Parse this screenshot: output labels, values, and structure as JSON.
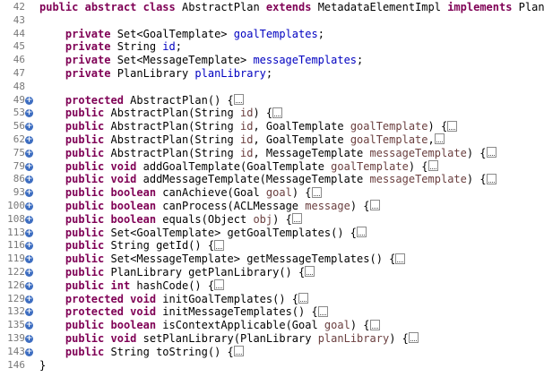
{
  "editor": {
    "lines": [
      {
        "num": "42",
        "fold": false,
        "tokens": [
          [
            "kw",
            "public"
          ],
          [
            "plain",
            " "
          ],
          [
            "kw",
            "abstract"
          ],
          [
            "plain",
            " "
          ],
          [
            "kw",
            "class"
          ],
          [
            "plain",
            " AbstractPlan "
          ],
          [
            "kw",
            "extends"
          ],
          [
            "plain",
            " MetadataElementImpl "
          ],
          [
            "kw",
            "implements"
          ],
          [
            "plain",
            " Plan {"
          ]
        ]
      },
      {
        "num": "43",
        "fold": false,
        "tokens": []
      },
      {
        "num": "44",
        "fold": false,
        "tokens": [
          [
            "plain",
            "    "
          ],
          [
            "kw",
            "private"
          ],
          [
            "plain",
            " Set<GoalTemplate> "
          ],
          [
            "fld",
            "goalTemplates"
          ],
          [
            "plain",
            ";"
          ]
        ]
      },
      {
        "num": "45",
        "fold": false,
        "tokens": [
          [
            "plain",
            "    "
          ],
          [
            "kw",
            "private"
          ],
          [
            "plain",
            " String "
          ],
          [
            "fld",
            "id"
          ],
          [
            "plain",
            ";"
          ]
        ]
      },
      {
        "num": "46",
        "fold": false,
        "tokens": [
          [
            "plain",
            "    "
          ],
          [
            "kw",
            "private"
          ],
          [
            "plain",
            " Set<MessageTemplate> "
          ],
          [
            "fld",
            "messageTemplates"
          ],
          [
            "plain",
            ";"
          ]
        ]
      },
      {
        "num": "47",
        "fold": false,
        "tokens": [
          [
            "plain",
            "    "
          ],
          [
            "kw",
            "private"
          ],
          [
            "plain",
            " PlanLibrary "
          ],
          [
            "fld",
            "planLibrary"
          ],
          [
            "plain",
            ";"
          ]
        ]
      },
      {
        "num": "48",
        "fold": false,
        "tokens": []
      },
      {
        "num": "49",
        "fold": true,
        "tokens": [
          [
            "plain",
            "    "
          ],
          [
            "kw",
            "protected"
          ],
          [
            "plain",
            " AbstractPlan() {"
          ],
          [
            "box",
            ""
          ]
        ]
      },
      {
        "num": "53",
        "fold": true,
        "tokens": [
          [
            "plain",
            "    "
          ],
          [
            "kw",
            "public"
          ],
          [
            "plain",
            " AbstractPlan(String "
          ],
          [
            "prm",
            "id"
          ],
          [
            "plain",
            ") {"
          ],
          [
            "box",
            ""
          ]
        ]
      },
      {
        "num": "56",
        "fold": true,
        "tokens": [
          [
            "plain",
            "    "
          ],
          [
            "kw",
            "public"
          ],
          [
            "plain",
            " AbstractPlan(String "
          ],
          [
            "prm",
            "id"
          ],
          [
            "plain",
            ", GoalTemplate "
          ],
          [
            "prm",
            "goalTemplate"
          ],
          [
            "plain",
            ") {"
          ],
          [
            "box",
            ""
          ]
        ]
      },
      {
        "num": "62",
        "fold": true,
        "tokens": [
          [
            "plain",
            "    "
          ],
          [
            "kw",
            "public"
          ],
          [
            "plain",
            " AbstractPlan(String "
          ],
          [
            "prm",
            "id"
          ],
          [
            "plain",
            ", GoalTemplate "
          ],
          [
            "prm",
            "goalTemplate"
          ],
          [
            "plain",
            ","
          ],
          [
            "box",
            ""
          ]
        ]
      },
      {
        "num": "75",
        "fold": true,
        "tokens": [
          [
            "plain",
            "    "
          ],
          [
            "kw",
            "public"
          ],
          [
            "plain",
            " AbstractPlan(String "
          ],
          [
            "prm",
            "id"
          ],
          [
            "plain",
            ", MessageTemplate "
          ],
          [
            "prm",
            "messageTemplate"
          ],
          [
            "plain",
            ") {"
          ],
          [
            "box",
            ""
          ]
        ]
      },
      {
        "num": "79",
        "fold": true,
        "tokens": [
          [
            "plain",
            "    "
          ],
          [
            "kw",
            "public"
          ],
          [
            "plain",
            " "
          ],
          [
            "kw",
            "void"
          ],
          [
            "plain",
            " addGoalTemplate(GoalTemplate "
          ],
          [
            "prm",
            "goalTemplate"
          ],
          [
            "plain",
            ") {"
          ],
          [
            "box",
            ""
          ]
        ]
      },
      {
        "num": "86",
        "fold": true,
        "tokens": [
          [
            "plain",
            "    "
          ],
          [
            "kw",
            "public"
          ],
          [
            "plain",
            " "
          ],
          [
            "kw",
            "void"
          ],
          [
            "plain",
            " addMessageTemplate(MessageTemplate "
          ],
          [
            "prm",
            "messageTemplate"
          ],
          [
            "plain",
            ") {"
          ],
          [
            "box",
            ""
          ]
        ]
      },
      {
        "num": "93",
        "fold": true,
        "tokens": [
          [
            "plain",
            "    "
          ],
          [
            "kw",
            "public"
          ],
          [
            "plain",
            " "
          ],
          [
            "kw",
            "boolean"
          ],
          [
            "plain",
            " canAchieve(Goal "
          ],
          [
            "prm",
            "goal"
          ],
          [
            "plain",
            ") {"
          ],
          [
            "box",
            ""
          ]
        ]
      },
      {
        "num": "100",
        "fold": true,
        "tokens": [
          [
            "plain",
            "    "
          ],
          [
            "kw",
            "public"
          ],
          [
            "plain",
            " "
          ],
          [
            "kw",
            "boolean"
          ],
          [
            "plain",
            " canProcess(ACLMessage "
          ],
          [
            "prm",
            "message"
          ],
          [
            "plain",
            ") {"
          ],
          [
            "box",
            ""
          ]
        ]
      },
      {
        "num": "108",
        "fold": true,
        "tokens": [
          [
            "plain",
            "    "
          ],
          [
            "kw",
            "public"
          ],
          [
            "plain",
            " "
          ],
          [
            "kw",
            "boolean"
          ],
          [
            "plain",
            " equals(Object "
          ],
          [
            "prm",
            "obj"
          ],
          [
            "plain",
            ") {"
          ],
          [
            "box",
            ""
          ]
        ]
      },
      {
        "num": "113",
        "fold": true,
        "tokens": [
          [
            "plain",
            "    "
          ],
          [
            "kw",
            "public"
          ],
          [
            "plain",
            " Set<GoalTemplate> getGoalTemplates() {"
          ],
          [
            "box",
            ""
          ]
        ]
      },
      {
        "num": "116",
        "fold": true,
        "tokens": [
          [
            "plain",
            "    "
          ],
          [
            "kw",
            "public"
          ],
          [
            "plain",
            " String getId() {"
          ],
          [
            "box",
            ""
          ]
        ]
      },
      {
        "num": "119",
        "fold": true,
        "tokens": [
          [
            "plain",
            "    "
          ],
          [
            "kw",
            "public"
          ],
          [
            "plain",
            " Set<MessageTemplate> getMessageTemplates() {"
          ],
          [
            "box",
            ""
          ]
        ]
      },
      {
        "num": "122",
        "fold": true,
        "tokens": [
          [
            "plain",
            "    "
          ],
          [
            "kw",
            "public"
          ],
          [
            "plain",
            " PlanLibrary getPlanLibrary() {"
          ],
          [
            "box",
            ""
          ]
        ]
      },
      {
        "num": "126",
        "fold": true,
        "tokens": [
          [
            "plain",
            "    "
          ],
          [
            "kw",
            "public"
          ],
          [
            "plain",
            " "
          ],
          [
            "kw",
            "int"
          ],
          [
            "plain",
            " hashCode() {"
          ],
          [
            "box",
            ""
          ]
        ]
      },
      {
        "num": "129",
        "fold": true,
        "tokens": [
          [
            "plain",
            "    "
          ],
          [
            "kw",
            "protected"
          ],
          [
            "plain",
            " "
          ],
          [
            "kw",
            "void"
          ],
          [
            "plain",
            " initGoalTemplates() {"
          ],
          [
            "box",
            ""
          ]
        ]
      },
      {
        "num": "132",
        "fold": true,
        "tokens": [
          [
            "plain",
            "    "
          ],
          [
            "kw",
            "protected"
          ],
          [
            "plain",
            " "
          ],
          [
            "kw",
            "void"
          ],
          [
            "plain",
            " initMessageTemplates() {"
          ],
          [
            "box",
            ""
          ]
        ]
      },
      {
        "num": "135",
        "fold": true,
        "tokens": [
          [
            "plain",
            "    "
          ],
          [
            "kw",
            "public"
          ],
          [
            "plain",
            " "
          ],
          [
            "kw",
            "boolean"
          ],
          [
            "plain",
            " isContextApplicable(Goal "
          ],
          [
            "prm",
            "goal"
          ],
          [
            "plain",
            ") {"
          ],
          [
            "box",
            ""
          ]
        ]
      },
      {
        "num": "139",
        "fold": true,
        "tokens": [
          [
            "plain",
            "    "
          ],
          [
            "kw",
            "public"
          ],
          [
            "plain",
            " "
          ],
          [
            "kw",
            "void"
          ],
          [
            "plain",
            " setPlanLibrary(PlanLibrary "
          ],
          [
            "prm",
            "planLibrary"
          ],
          [
            "plain",
            ") {"
          ],
          [
            "box",
            ""
          ]
        ]
      },
      {
        "num": "143",
        "fold": true,
        "tokens": [
          [
            "plain",
            "    "
          ],
          [
            "kw",
            "public"
          ],
          [
            "plain",
            " String toString() {"
          ],
          [
            "box",
            ""
          ]
        ]
      },
      {
        "num": "146",
        "fold": false,
        "tokens": [
          [
            "plain",
            "}"
          ]
        ]
      }
    ],
    "fold_icon_glyph": "+",
    "colors": {
      "keyword": "#7f0055",
      "field": "#0000c0",
      "parameter": "#6a3e3e",
      "line_number": "#787878",
      "fold_icon": "#3e6ec1"
    }
  }
}
